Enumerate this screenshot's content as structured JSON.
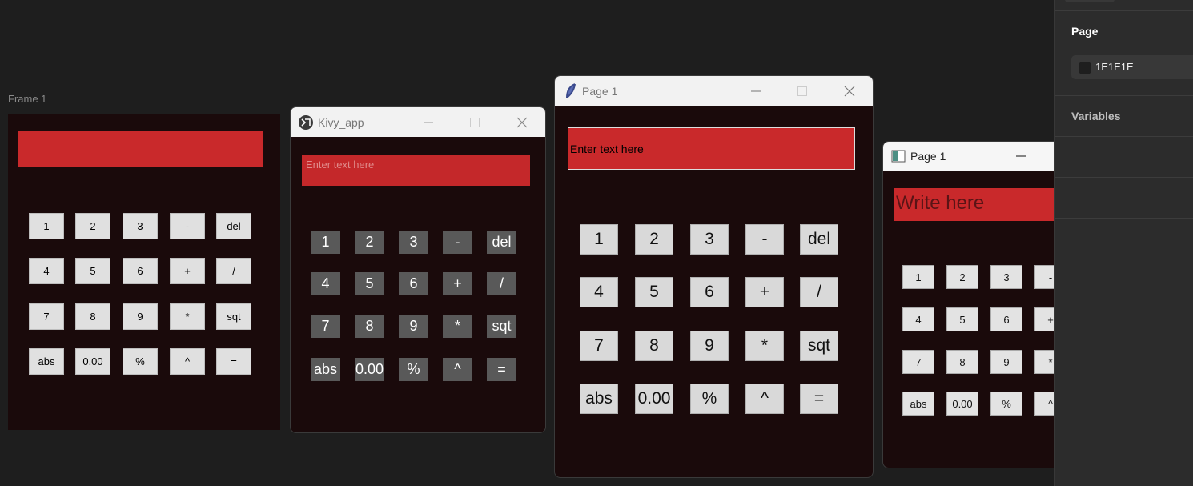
{
  "canvas": {
    "frame_label": "Frame 1"
  },
  "keys": [
    "1",
    "2",
    "3",
    "-",
    "del",
    "4",
    "5",
    "6",
    "+",
    "/",
    "7",
    "8",
    "9",
    "*",
    "sqt",
    "abs",
    "0.00",
    "%",
    "^",
    "="
  ],
  "kivy_window": {
    "title": "Kivy_app",
    "input_placeholder": "Enter text here"
  },
  "tk_window": {
    "title": "Page 1",
    "input_text": "Enter text here"
  },
  "qt_window": {
    "title": "Page 1",
    "input_placeholder": "Write here"
  },
  "right_panel": {
    "page_heading": "Page",
    "fill_value": "1E1E1E",
    "variables_heading": "Variables"
  },
  "colors": {
    "canvas_bg": "#1e1e1e",
    "app_bg": "#1a0a0b",
    "display_red": "#c9292b"
  }
}
